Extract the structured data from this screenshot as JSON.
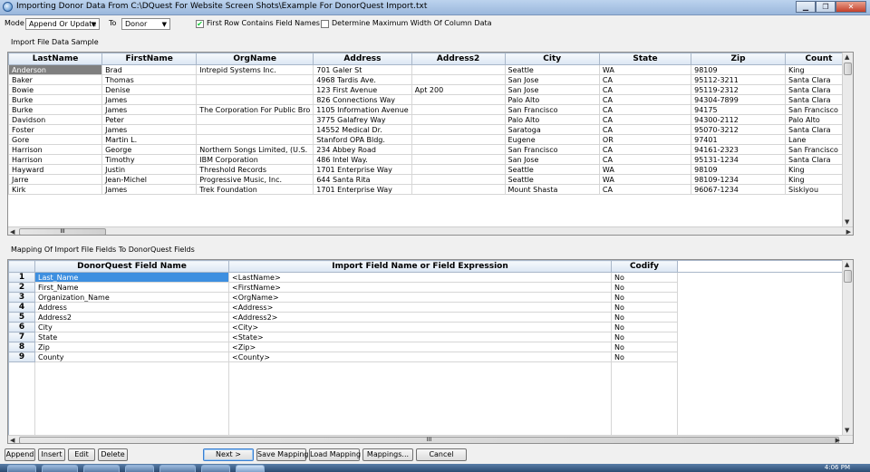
{
  "window": {
    "title": "Importing Donor Data From C:\\DQuest For Website Screen Shots\\Example For DonorQuest Import.txt",
    "min_label": "▁",
    "max_label": "❐",
    "close_label": "✕"
  },
  "toolbar": {
    "mode_label": "Mode",
    "mode_value": "Append Or Update",
    "to_label": "To",
    "to_value": "Donor",
    "first_row_label": "First Row Contains Field Names",
    "first_row_checked": true,
    "max_width_label": "Determine Maximum Width Of Column Data",
    "max_width_checked": false
  },
  "sample": {
    "section_label": "Import File Data Sample",
    "columns": [
      "LastName",
      "FirstName",
      "OrgName",
      "Address",
      "Address2",
      "City",
      "State",
      "Zip",
      "Count"
    ],
    "rows": [
      [
        "Anderson",
        "Brad",
        "Intrepid Systems Inc.",
        "701 Galer St",
        "",
        "Seattle",
        "WA",
        "98109",
        "King"
      ],
      [
        "Baker",
        "Thomas",
        "",
        "4968 Tardis Ave.",
        "",
        "San Jose",
        "CA",
        "95112-3211",
        "Santa Clara"
      ],
      [
        "Bowie",
        "Denise",
        "",
        "123 First Avenue",
        "Apt 200",
        "San Jose",
        "CA",
        "95119-2312",
        "Santa Clara"
      ],
      [
        "Burke",
        "James",
        "",
        "826 Connections Way",
        "",
        "Palo Alto",
        "CA",
        "94304-7899",
        "Santa Clara"
      ],
      [
        "Burke",
        "James",
        "The Corporation For Public Bro",
        "1105 Information Avenue",
        "",
        "San Francisco",
        "CA",
        "94175",
        "San Francisco"
      ],
      [
        "Davidson",
        "Peter",
        "",
        "3775 Galafrey Way",
        "",
        "Palo Alto",
        "CA",
        "94300-2112",
        "Palo Alto"
      ],
      [
        "Foster",
        "James",
        "",
        "14552 Medical Dr.",
        "",
        "Saratoga",
        "CA",
        "95070-3212",
        "Santa Clara"
      ],
      [
        "Gore",
        "Martin L.",
        "",
        "Stanford OPA Bldg.",
        "",
        "Eugene",
        "OR",
        "97401",
        "Lane"
      ],
      [
        "Harrison",
        "George",
        "Northern Songs Limited, (U.S.",
        "234 Abbey Road",
        "",
        "San Francisco",
        "CA",
        "94161-2323",
        "San Francisco"
      ],
      [
        "Harrison",
        "Timothy",
        "IBM Corporation",
        "486 Intel Way.",
        "",
        "San Jose",
        "CA",
        "95131-1234",
        "Santa Clara"
      ],
      [
        "Hayward",
        "Justin",
        "Threshold Records",
        "1701 Enterprise Way",
        "",
        "Seattle",
        "WA",
        "98109",
        "King"
      ],
      [
        "Jarre",
        "Jean-Michel",
        "Progressive Music, Inc.",
        "644 Santa Rita",
        "",
        "Seattle",
        "WA",
        "98109-1234",
        "King"
      ],
      [
        "Kirk",
        "James",
        "Trek Foundation",
        "1701 Enterprise Way",
        "",
        "Mount Shasta",
        "CA",
        "96067-1234",
        "Siskiyou"
      ]
    ],
    "hscroll_grip": "III"
  },
  "mapping": {
    "section_label": "Mapping Of Import File Fields To DonorQuest Fields",
    "columns": [
      "DonorQuest Field Name",
      "Import Field Name or Field Expression",
      "Codify"
    ],
    "rows": [
      {
        "num": "1",
        "field": "Last_Name",
        "expr": "<LastName>",
        "codify": "No"
      },
      {
        "num": "2",
        "field": "First_Name",
        "expr": "<FirstName>",
        "codify": "No"
      },
      {
        "num": "3",
        "field": "Organization_Name",
        "expr": "<OrgName>",
        "codify": "No"
      },
      {
        "num": "4",
        "field": "Address",
        "expr": "<Address>",
        "codify": "No"
      },
      {
        "num": "5",
        "field": "Address2",
        "expr": "<Address2>",
        "codify": "No"
      },
      {
        "num": "6",
        "field": "City",
        "expr": "<City>",
        "codify": "No"
      },
      {
        "num": "7",
        "field": "State",
        "expr": "<State>",
        "codify": "No"
      },
      {
        "num": "8",
        "field": "Zip",
        "expr": "<Zip>",
        "codify": "No"
      },
      {
        "num": "9",
        "field": "County",
        "expr": "<County>",
        "codify": "No"
      }
    ],
    "hscroll_grip": "III"
  },
  "buttons": {
    "append": "Append",
    "insert": "Insert",
    "edit": "Edit",
    "delete": "Delete",
    "next": "Next >",
    "save_mapping": "Save Mapping",
    "load_mapping": "Load Mapping",
    "mappings": "Mappings...",
    "cancel": "Cancel"
  },
  "taskbar": {
    "clock": "4:06 PM"
  },
  "colors": {
    "selection": "#3d8fe0",
    "row_select": "#7f7f7f",
    "titlebar": "#bcd3ee",
    "close_button": "#c4402a"
  }
}
